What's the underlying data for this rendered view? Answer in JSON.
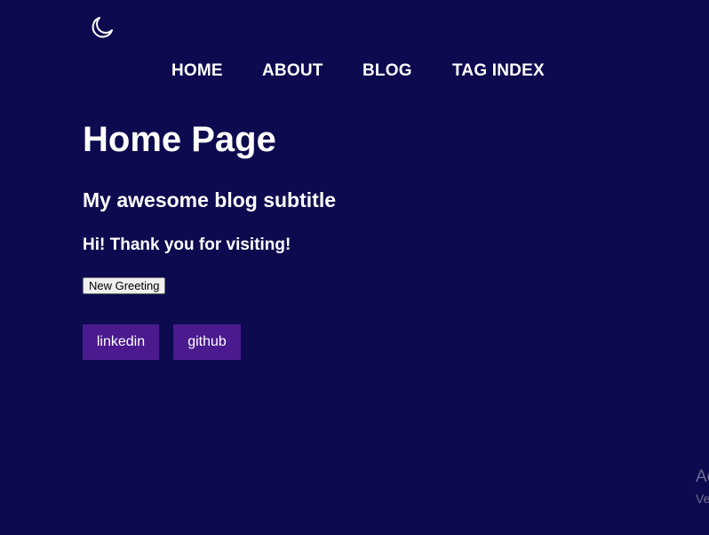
{
  "header": {
    "theme_toggle_icon": "moon-icon"
  },
  "nav": {
    "items": [
      {
        "label": "HOME"
      },
      {
        "label": "ABOUT"
      },
      {
        "label": "BLOG"
      },
      {
        "label": "TAG INDEX"
      }
    ]
  },
  "main": {
    "title": "Home Page",
    "subtitle": "My awesome blog subtitle",
    "greeting": "Hi! Thank you for visiting!",
    "greeting_button": "New Greeting",
    "social": [
      {
        "label": "linkedin"
      },
      {
        "label": "github"
      }
    ]
  },
  "watermark": {
    "line1": "Ac",
    "line2": "Ve"
  },
  "colors": {
    "background": "#0d0a4f",
    "social_button": "#4a1a8e",
    "text": "#ffffff"
  }
}
